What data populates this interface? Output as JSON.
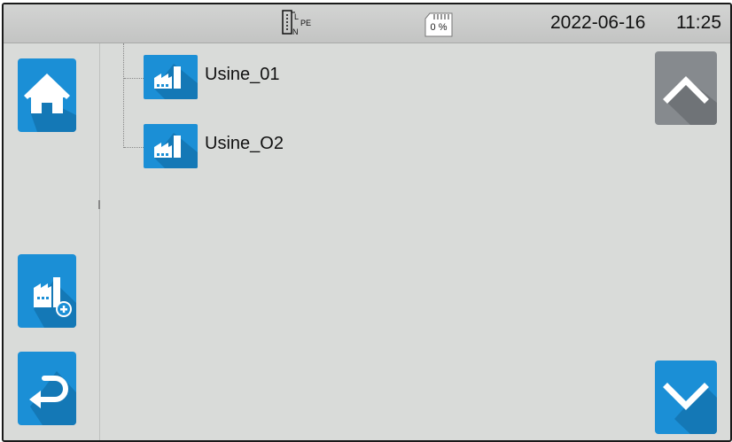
{
  "statusbar": {
    "wiring": {
      "line": "L",
      "neutral": "N",
      "earth": "PE"
    },
    "memory_usage": "0 %",
    "date": "2022-06-16",
    "time": "11:25"
  },
  "sidebar": {
    "buttons": [
      {
        "icon": "home-icon"
      },
      {
        "icon": "add-site-icon"
      },
      {
        "icon": "back-arrow-icon"
      }
    ]
  },
  "tree": {
    "items": [
      {
        "label": "Usine_01",
        "icon": "factory-icon"
      },
      {
        "label": "Usine_O2",
        "icon": "factory-icon"
      }
    ]
  },
  "scroll": {
    "up_icon": "chevron-up-icon",
    "down_icon": "chevron-down-icon"
  },
  "colors": {
    "accent_blue": "#1b8fd6",
    "disabled_gray": "#868a8e",
    "background": "#d9dbd9",
    "statusbar": "#c8c9c8"
  }
}
